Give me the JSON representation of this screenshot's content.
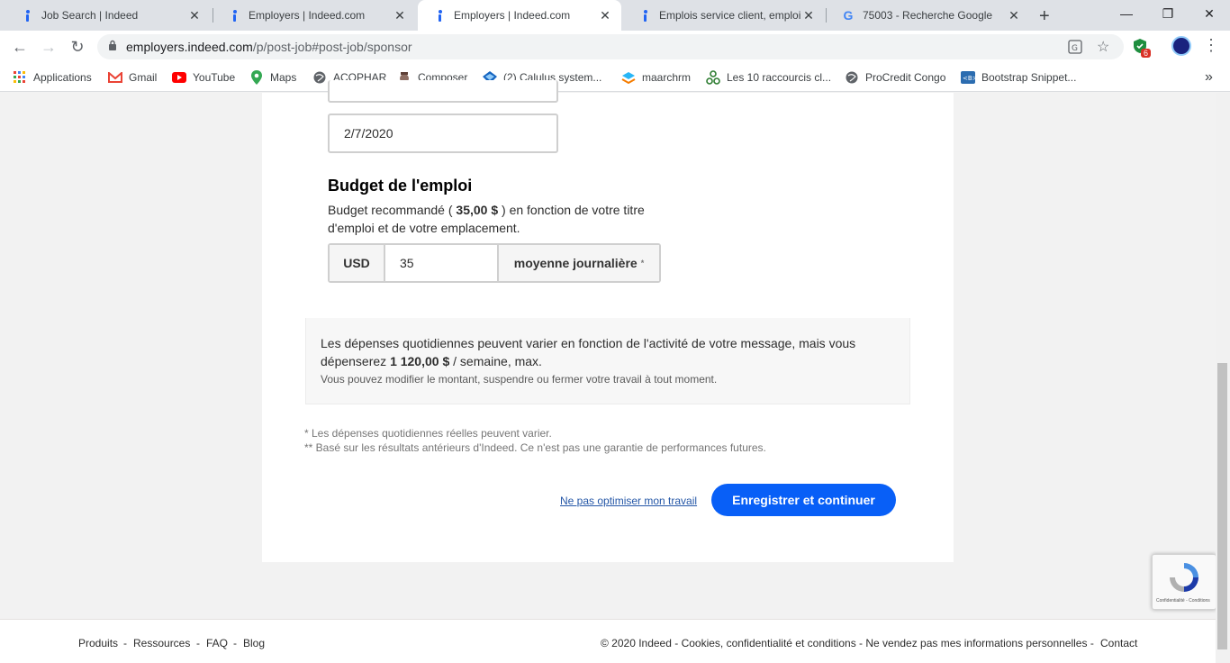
{
  "browser": {
    "tabs": [
      {
        "title": "Job Search | Indeed",
        "favicon": "indeed-icon"
      },
      {
        "title": "Employers | Indeed.com",
        "favicon": "indeed-icon"
      },
      {
        "title": "Employers | Indeed.com",
        "favicon": "indeed-icon",
        "active": true
      },
      {
        "title": "Emplois service client, emploi",
        "favicon": "indeed-icon"
      },
      {
        "title": "75003 - Recherche Google",
        "favicon": "google-icon"
      }
    ],
    "new_tab_label": "+",
    "address": {
      "domain": "employers.indeed.com",
      "path": "/p/post-job#post-job/sponsor"
    },
    "extension_badge": "6",
    "bookmarks": [
      {
        "label": "Applications",
        "icon": "apps-grid-icon"
      },
      {
        "label": "Gmail",
        "icon": "gmail-icon"
      },
      {
        "label": "YouTube",
        "icon": "youtube-icon"
      },
      {
        "label": "Maps",
        "icon": "maps-icon"
      },
      {
        "label": "ACOPHAR",
        "icon": "globe-icon"
      },
      {
        "label": "Composer",
        "icon": "composer-icon"
      },
      {
        "label": "(2) Calulus system...",
        "icon": "calulus-icon"
      },
      {
        "label": "maarchrm",
        "icon": "maarch-icon"
      },
      {
        "label": "Les 10 raccourcis cl...",
        "icon": "shortcut-icon"
      },
      {
        "label": "ProCredit Congo",
        "icon": "globe-icon"
      },
      {
        "label": "Bootstrap Snippet...",
        "icon": "bootstrap-icon"
      }
    ],
    "overflow_label": "»"
  },
  "form": {
    "date_value": "2/7/2020",
    "budget_title": "Budget de l'emploi",
    "budget_desc_prefix": "Budget recommandé ( ",
    "budget_recommended": "35,00 $",
    "budget_desc_suffix": " ) en fonction de votre titre d'emploi et de votre emplacement.",
    "currency": "USD",
    "amount": "35",
    "period_label": "moyenne journalière",
    "period_marker": "*",
    "info_prefix": "Les dépenses quotidiennes peuvent varier en fonction de l'activité de votre message, mais vous dépenserez ",
    "info_max": "1 120,00 $",
    "info_suffix": " / semaine, max.",
    "info_sub": "Vous pouvez modifier le montant, suspendre ou fermer votre travail à tout moment.",
    "note_1": "* Les dépenses quotidiennes réelles peuvent varier.",
    "note_2": "** Basé sur les résultats antérieurs d'Indeed. Ce n'est pas une garantie de performances futures.",
    "skip_link": "Ne pas optimiser mon travail",
    "save_button": "Enregistrer et continuer"
  },
  "recaptcha": {
    "label": "Confidentialité - Conditions"
  },
  "footer": {
    "left_links": [
      "Produits",
      "-",
      "Ressources",
      "-",
      "FAQ",
      "-",
      "Blog"
    ],
    "right_text": "© 2020 Indeed - Cookies, confidentialité et conditions - Ne vendez pas mes informations personnelles -",
    "contact": "Contact"
  },
  "colors": {
    "accent": "#085ff7",
    "link": "#2557a7"
  }
}
